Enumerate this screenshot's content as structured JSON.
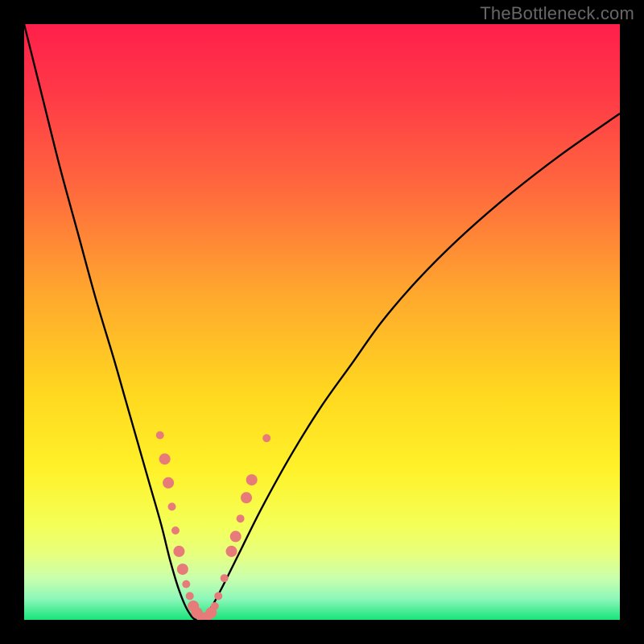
{
  "watermark": "TheBottleneck.com",
  "chart_data": {
    "type": "line",
    "title": "",
    "xlabel": "",
    "ylabel": "",
    "xlim": [
      0,
      100
    ],
    "ylim": [
      0,
      100
    ],
    "series": [
      {
        "name": "bottleneck-curve",
        "x": [
          0,
          3,
          6,
          9,
          12,
          15,
          17,
          19,
          21,
          23,
          24.5,
          26,
          27.5,
          29,
          31,
          33,
          36,
          40,
          45,
          50,
          55,
          60,
          66,
          73,
          81,
          90,
          100
        ],
        "y": [
          100,
          88,
          76,
          65,
          54,
          44,
          37,
          30,
          23,
          16,
          10,
          5,
          1.5,
          0,
          1.5,
          5,
          11,
          19,
          28,
          36,
          43,
          50,
          57,
          64,
          71,
          78,
          85
        ]
      }
    ],
    "markers": {
      "name": "highlight-points",
      "color": "#e77b79",
      "points": [
        {
          "x": 22.8,
          "y": 31,
          "r": 5
        },
        {
          "x": 23.6,
          "y": 27,
          "r": 7
        },
        {
          "x": 24.2,
          "y": 23,
          "r": 7
        },
        {
          "x": 24.8,
          "y": 19,
          "r": 5
        },
        {
          "x": 25.4,
          "y": 15,
          "r": 5
        },
        {
          "x": 26.0,
          "y": 11.5,
          "r": 7
        },
        {
          "x": 26.6,
          "y": 8.5,
          "r": 7
        },
        {
          "x": 27.2,
          "y": 6,
          "r": 5
        },
        {
          "x": 27.8,
          "y": 4,
          "r": 5
        },
        {
          "x": 28.4,
          "y": 2.3,
          "r": 7
        },
        {
          "x": 29.0,
          "y": 1.2,
          "r": 7
        },
        {
          "x": 29.6,
          "y": 0.6,
          "r": 6
        },
        {
          "x": 30.2,
          "y": 0.4,
          "r": 6
        },
        {
          "x": 30.8,
          "y": 0.6,
          "r": 6
        },
        {
          "x": 31.4,
          "y": 1.2,
          "r": 7
        },
        {
          "x": 32.0,
          "y": 2.3,
          "r": 5
        },
        {
          "x": 32.6,
          "y": 4,
          "r": 5
        },
        {
          "x": 33.6,
          "y": 7,
          "r": 5
        },
        {
          "x": 34.8,
          "y": 11.5,
          "r": 7
        },
        {
          "x": 35.5,
          "y": 14,
          "r": 7
        },
        {
          "x": 36.3,
          "y": 17,
          "r": 5
        },
        {
          "x": 37.3,
          "y": 20.5,
          "r": 7
        },
        {
          "x": 38.2,
          "y": 23.5,
          "r": 7
        },
        {
          "x": 40.7,
          "y": 30.5,
          "r": 5
        }
      ]
    },
    "gradient_stops": [
      {
        "pos": 0.0,
        "color": "#ff1f4b"
      },
      {
        "pos": 0.12,
        "color": "#ff3a47"
      },
      {
        "pos": 0.28,
        "color": "#ff6a3d"
      },
      {
        "pos": 0.45,
        "color": "#ffa72e"
      },
      {
        "pos": 0.62,
        "color": "#ffd81f"
      },
      {
        "pos": 0.75,
        "color": "#fff22a"
      },
      {
        "pos": 0.84,
        "color": "#f4ff57"
      },
      {
        "pos": 0.89,
        "color": "#e7ff7e"
      },
      {
        "pos": 0.93,
        "color": "#c9ffad"
      },
      {
        "pos": 0.965,
        "color": "#8cf7b9"
      },
      {
        "pos": 1.0,
        "color": "#18e47a"
      }
    ]
  }
}
